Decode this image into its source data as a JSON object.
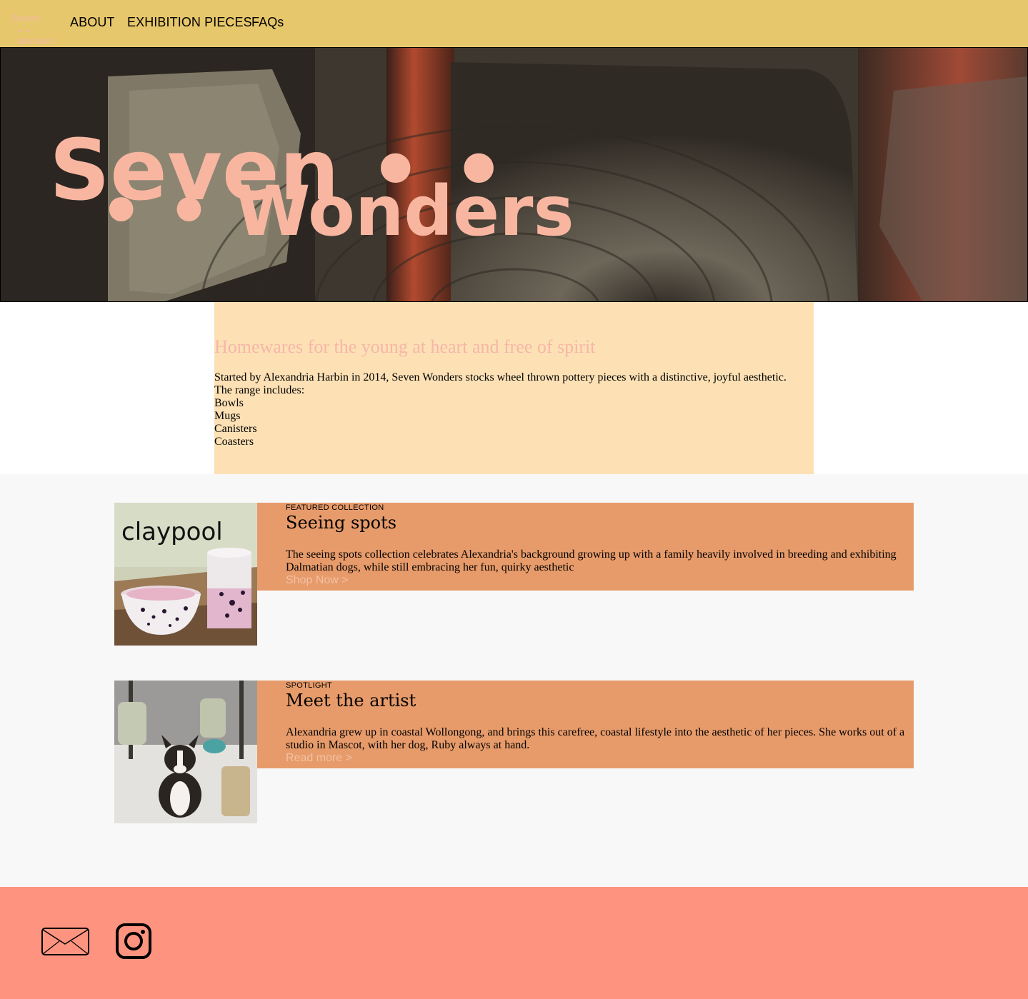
{
  "nav": {
    "logo_line1": "Seven",
    "logo_line2": "• • Wonders",
    "links": [
      "ABOUT",
      "EXHIBITION PIECES",
      "FAQs"
    ]
  },
  "hero": {
    "line1": "Seven • •",
    "line2": "• • Wonders",
    "text_color": "#f8b6a0"
  },
  "intro": {
    "heading": "Homewares for the young at heart and free of spirit",
    "paragraph": "Started by Alexandria Harbin in 2014, Seven Wonders stocks wheel thrown pottery pieces with a distinctive, joyful aesthetic.",
    "range_label": "The range includes:",
    "items": [
      "Bowls",
      "Mugs",
      "Canisters",
      "Coasters"
    ]
  },
  "cards": [
    {
      "eyebrow": "FEATURED COLLECTION",
      "title": "Seeing spots",
      "text": "The seeing spots collection celebrates Alexandria's background growing up with a family heavily involved in breeding and exhibiting Dalmatian dogs, while still embracing her fun, quirky aesthetic",
      "link": "Shop Now >",
      "image_caption": "claypool"
    },
    {
      "eyebrow": "SPOTLIGHT",
      "title": "Meet the artist",
      "text": "Alexandria grew up in coastal Wollongong, and brings this carefree, coastal lifestyle into the aesthetic of her pieces. She works out of a studio in Mascot, with her dog, Ruby always at hand.",
      "link": "Read more >"
    }
  ],
  "footer": {
    "icons": [
      "email-icon",
      "instagram-icon"
    ]
  },
  "colors": {
    "nav_bg": "#e7c76b",
    "intro_bg": "#fde1b5",
    "heading": "#f6b6a9",
    "card_bg": "#e79b6a",
    "footer_bg": "#fe947f",
    "page_bg": "#f8f8f8"
  }
}
